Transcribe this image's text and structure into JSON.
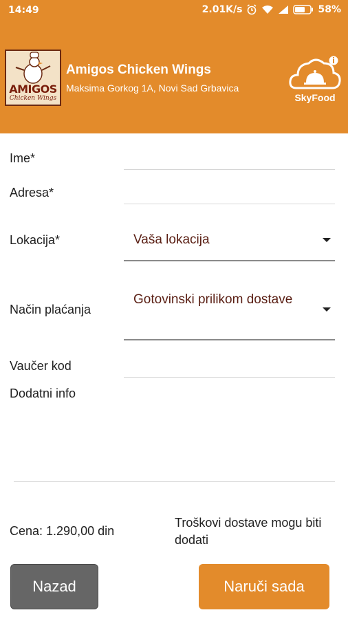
{
  "status_bar": {
    "time": "14:49",
    "speed": "2.01K/s",
    "battery": "58%",
    "icons": [
      "alarm-icon",
      "wifi-icon",
      "signal-icon",
      "battery-icon"
    ]
  },
  "header": {
    "logo": {
      "main": "AMIGOS",
      "sub": "Chicken Wings"
    },
    "restaurant_name": "Amigos Chicken Wings",
    "address": "Maksima Gorkog 1A, Novi Sad Grbavica",
    "brand": "SkyFood",
    "background_color": "#e38b2b"
  },
  "form": {
    "name_label": "Ime*",
    "name_value": "",
    "address_label": "Adresa*",
    "address_value": "",
    "location_label": "Lokacija*",
    "location_selected": "Vaša lokacija",
    "payment_label": "Način plaćanja",
    "payment_selected": "Gotovinski prilikom dostave",
    "voucher_label": "Vaučer kod",
    "voucher_value": "",
    "info_label": "Dodatni info",
    "info_value": ""
  },
  "summary": {
    "price": "Cena:  1.290,00 din",
    "delivery_note": "Troškovi dostave mogu biti dodati"
  },
  "buttons": {
    "back": "Nazad",
    "order": "Naruči sada"
  },
  "colors": {
    "accent": "#e38b2b",
    "back_button": "#666666",
    "select_text": "#5a1f14"
  }
}
